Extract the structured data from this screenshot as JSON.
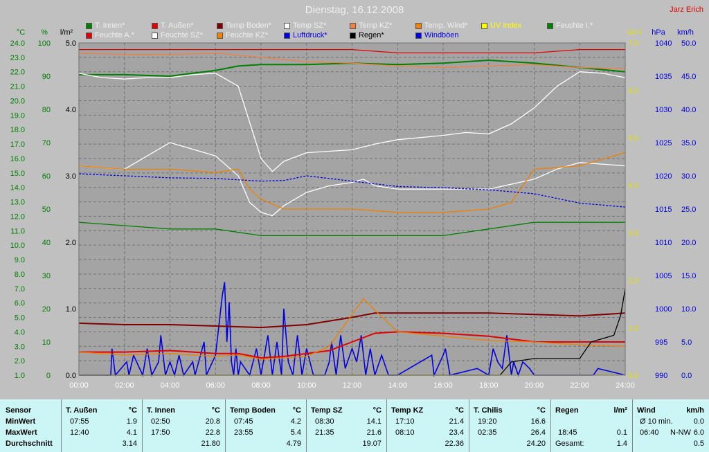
{
  "title": "Dienstag, 16.12.2008",
  "author": "Jarz Erich",
  "axes": {
    "temp_unit": "°C",
    "pct_unit": "%",
    "rain_unit": "l/m²",
    "uv_unit": "UV-I",
    "pressure_unit": "hPa",
    "wind_unit": "km/h",
    "temp_ticks": [
      "24.0",
      "23.0",
      "22.0",
      "21.0",
      "20.0",
      "19.0",
      "18.0",
      "17.0",
      "16.0",
      "15.0",
      "14.0",
      "13.0",
      "12.0",
      "11.0",
      "10.0",
      "9.0",
      "8.0",
      "7.0",
      "6.0",
      "5.0",
      "4.0",
      "3.0",
      "2.0",
      "1.0"
    ],
    "pct_ticks": [
      "100",
      "90",
      "80",
      "70",
      "60",
      "50",
      "40",
      "30",
      "20",
      "10",
      "0"
    ],
    "rain_ticks": [
      "5.0",
      "4.0",
      "3.0",
      "2.0",
      "1.0",
      "0.0"
    ],
    "uv_ticks": [
      "7.0",
      "6.0",
      "5.0",
      "4.0",
      "3.0",
      "2.0",
      "1.0",
      "0.0"
    ],
    "pressure_ticks": [
      "1040",
      "1035",
      "1030",
      "1025",
      "1020",
      "1015",
      "1010",
      "1005",
      "1000",
      "995",
      "990"
    ],
    "wind_ticks": [
      "50.0",
      "45.0",
      "40.0",
      "35.0",
      "30.0",
      "25.0",
      "20.0",
      "15.0",
      "10.0",
      "5.0",
      "0.0"
    ],
    "time_ticks": [
      "00:00",
      "02:00",
      "04:00",
      "06:00",
      "08:00",
      "10:00",
      "12:00",
      "14:00",
      "16:00",
      "18:00",
      "20:00",
      "22:00",
      "24:00"
    ]
  },
  "legend": [
    {
      "label": "T. Innen*",
      "color": "#008000"
    },
    {
      "label": "T. Außen*",
      "color": "#E00000"
    },
    {
      "label": "Temp Boden*",
      "color": "#800000"
    },
    {
      "label": "Temp SZ*",
      "color": "#FFFFFF"
    },
    {
      "label": "Temp KZ*",
      "color": "#F08040"
    },
    {
      "label": "Temp. Wind*",
      "color": "#F08000"
    },
    {
      "label": "UV Index",
      "color": "#FFFF00"
    },
    {
      "label": "Feuchte I.*",
      "color": "#008000"
    },
    {
      "label": "Feuchte A.*",
      "color": "#E00000"
    },
    {
      "label": "Feuchte SZ*",
      "color": "#FFFFFF"
    },
    {
      "label": "Feuchte KZ*",
      "color": "#F08000"
    },
    {
      "label": "Luftdruck*",
      "color": "#0000E0"
    },
    {
      "label": "Regen*",
      "color": "#000000"
    },
    {
      "label": "Windböen",
      "color": "#0000E0"
    }
  ],
  "colors": {
    "temp_axis": "#008000",
    "uv_axis": "#E0E000",
    "pressure_axis": "#0000E0",
    "plot_bg": "#A4A4A4",
    "grid": "#707070"
  },
  "chart_data": {
    "type": "line",
    "x_unit": "hours",
    "xlim": [
      0,
      24
    ],
    "temp_ylim": [
      1,
      24
    ],
    "pct_ylim": [
      0,
      100
    ],
    "rain_ylim": [
      0,
      5
    ],
    "pressure_ylim": [
      990,
      1040
    ],
    "wind_ylim": [
      0,
      50
    ],
    "series": [
      {
        "name": "T. Innen*",
        "axis": "temp",
        "color": "#008000",
        "x": [
          0,
          2,
          4,
          5,
          6,
          7,
          8,
          10,
          12,
          14,
          16,
          18,
          19,
          20,
          22,
          24
        ],
        "y": [
          21.8,
          21.8,
          21.7,
          21.9,
          22.1,
          22.4,
          22.5,
          22.5,
          22.6,
          22.5,
          22.6,
          22.8,
          22.7,
          22.6,
          22.3,
          22.0
        ]
      },
      {
        "name": "T. Außen*",
        "axis": "temp",
        "color": "#E00000",
        "x": [
          0,
          2,
          4,
          6,
          7,
          8,
          9,
          10,
          11,
          12,
          13,
          14,
          16,
          18,
          20,
          22,
          24
        ],
        "y": [
          2.6,
          2.6,
          2.7,
          2.5,
          2.5,
          2.2,
          2.3,
          2.5,
          2.7,
          3.3,
          3.9,
          4.0,
          3.9,
          3.7,
          3.3,
          3.3,
          3.3
        ]
      },
      {
        "name": "Temp Boden*",
        "axis": "temp",
        "color": "#800000",
        "x": [
          0,
          2,
          4,
          6,
          8,
          10,
          12,
          13,
          14,
          16,
          18,
          20,
          22,
          24
        ],
        "y": [
          4.6,
          4.5,
          4.5,
          4.4,
          4.3,
          4.5,
          5.0,
          5.3,
          5.3,
          5.3,
          5.3,
          5.2,
          5.1,
          5.3
        ]
      },
      {
        "name": "Temp SZ*",
        "axis": "temp",
        "color": "#FFFFFF",
        "x": [
          0,
          1,
          2,
          3,
          4,
          5,
          6,
          7,
          7.5,
          8,
          8.5,
          9,
          10,
          11,
          12,
          13,
          14,
          16,
          17,
          18,
          19,
          20,
          21,
          22,
          23,
          24
        ],
        "y": [
          21.9,
          21.6,
          21.5,
          21.6,
          21.6,
          21.8,
          21.9,
          21.0,
          18.5,
          16.0,
          15.1,
          15.8,
          16.4,
          16.5,
          16.6,
          17.0,
          17.3,
          17.6,
          17.8,
          17.7,
          18.4,
          19.5,
          21.0,
          22.0,
          21.9,
          21.6
        ]
      },
      {
        "name": "Temp KZ*",
        "axis": "temp",
        "color": "#F08040",
        "x": [
          0,
          2,
          4,
          6,
          8,
          10,
          12,
          14,
          16,
          18,
          20,
          22,
          24
        ],
        "y": [
          23.3,
          23.2,
          23.2,
          23.3,
          23.0,
          22.7,
          22.6,
          22.4,
          22.3,
          22.4,
          22.5,
          22.3,
          22.2
        ]
      },
      {
        "name": "Temp. Wind*",
        "axis": "temp",
        "color": "#F08000",
        "x": [
          0,
          2,
          4,
          6,
          7,
          8,
          9,
          10,
          11,
          12,
          12.5,
          13,
          14,
          16,
          18,
          20,
          22,
          24
        ],
        "y": [
          2.6,
          2.4,
          2.5,
          2.3,
          2.4,
          2.1,
          2.2,
          2.3,
          3.0,
          5.2,
          6.3,
          5.5,
          4.0,
          3.7,
          3.4,
          3.3,
          3.1,
          3.0
        ]
      },
      {
        "name": "Feuchte I.*",
        "axis": "pct",
        "color": "#008000",
        "x": [
          0,
          2,
          4,
          6,
          8,
          10,
          12,
          14,
          16,
          18,
          20,
          22,
          24
        ],
        "y": [
          46,
          45,
          44,
          44,
          42,
          42,
          42,
          42,
          42,
          44,
          46,
          46,
          46
        ]
      },
      {
        "name": "Feuchte A.*",
        "axis": "pct",
        "color": "#E00000",
        "x": [
          0,
          2,
          4,
          6,
          8,
          10,
          12,
          14,
          16,
          18,
          20,
          22,
          24
        ],
        "y": [
          98,
          98,
          98,
          98,
          98,
          98,
          98,
          97,
          97,
          97,
          97,
          98,
          98
        ]
      },
      {
        "name": "Feuchte SZ*",
        "axis": "pct",
        "color": "#FFFFFF",
        "x": [
          0,
          2,
          4,
          6,
          7,
          7.5,
          8,
          8.5,
          9,
          10,
          11,
          12,
          12.5,
          13,
          14,
          16,
          18,
          20,
          21,
          22,
          24
        ],
        "y": [
          63,
          62,
          70,
          66,
          60,
          52,
          49,
          48,
          51,
          55,
          57,
          58,
          59,
          57,
          56,
          56,
          56,
          59,
          62,
          64,
          63
        ]
      },
      {
        "name": "Feuchte KZ*",
        "axis": "pct",
        "color": "#F08000",
        "x": [
          0,
          2,
          4,
          6,
          7,
          7.5,
          8,
          9,
          10,
          12,
          14,
          16,
          18,
          19,
          20,
          22,
          24
        ],
        "y": [
          63,
          62,
          62,
          61,
          62,
          56,
          53,
          50,
          50,
          50,
          49,
          49,
          50,
          52,
          62,
          63,
          67
        ]
      },
      {
        "name": "Luftdruck*",
        "axis": "pressure",
        "color": "#0000E0",
        "dash": true,
        "x": [
          0,
          2,
          4,
          6,
          8,
          9,
          10,
          12,
          14,
          16,
          18,
          20,
          22,
          24
        ],
        "y": [
          1020.3,
          1020.0,
          1019.7,
          1019.6,
          1019.2,
          1019.3,
          1020.0,
          1019.2,
          1018.4,
          1018.2,
          1017.9,
          1017.3,
          1015.9,
          1015.3
        ]
      },
      {
        "name": "Regen*",
        "axis": "rain",
        "color": "#000000",
        "x": [
          0,
          18.5,
          19,
          20,
          21,
          22,
          22.5,
          23,
          23.5,
          23.8,
          24
        ],
        "y": [
          0,
          0,
          0.2,
          0.25,
          0.25,
          0.25,
          0.5,
          0.55,
          0.6,
          0.9,
          1.3
        ]
      },
      {
        "name": "UV Index",
        "axis": "uv",
        "color": "#FFFF00",
        "x": [
          0,
          24
        ],
        "y": [
          0,
          0
        ]
      }
    ],
    "gusts": {
      "name": "Windböen",
      "color": "#0000E0",
      "x": [
        0,
        0.6,
        1.4,
        1.45,
        1.6,
        2.1,
        2.2,
        2.4,
        2.8,
        3.0,
        3.2,
        3.5,
        3.6,
        3.8,
        4.0,
        4.2,
        4.4,
        4.6,
        5.0,
        5.1,
        5.5,
        5.6,
        6.0,
        6.3,
        6.4,
        6.5,
        6.6,
        6.7,
        6.8,
        6.9,
        7.0,
        7.1,
        7.5,
        7.8,
        8.0,
        8.3,
        8.5,
        8.7,
        8.9,
        9.0,
        9.2,
        9.4,
        9.6,
        9.8,
        10.0,
        10.3,
        10.8,
        11.0,
        11.1,
        11.3,
        11.5,
        11.7,
        12.0,
        12.2,
        12.4,
        12.6,
        12.8,
        13.0,
        13.3,
        13.6,
        13.8,
        14.0,
        15.5,
        15.6,
        16.0,
        16.1,
        16.3,
        17.5,
        18.0,
        18.2,
        18.4,
        18.6,
        18.8,
        19.0,
        19.1,
        19.3,
        19.5,
        19.8,
        20.0,
        22.6,
        22.8,
        24
      ],
      "y": [
        0,
        0,
        0,
        4,
        0,
        2,
        0,
        3,
        0,
        4,
        0,
        2,
        6,
        0,
        2,
        0,
        3,
        0,
        2,
        0,
        5,
        0,
        3,
        12,
        14,
        5,
        11,
        2,
        0,
        4,
        0,
        2,
        0,
        4,
        0,
        6,
        0,
        5,
        0,
        10,
        2,
        0,
        6,
        0,
        4,
        0,
        0,
        2,
        5,
        0,
        6,
        1,
        4,
        2,
        6,
        0,
        4,
        0,
        3,
        0,
        0,
        0,
        3,
        0,
        3,
        4,
        0,
        1,
        0,
        4,
        2,
        1,
        6,
        0,
        2,
        0,
        2,
        1,
        0,
        0,
        1,
        0
      ],
      "ylim": [
        0,
        50
      ]
    }
  },
  "summary": {
    "row_labels": {
      "sensor": "Sensor",
      "min": "MinWert",
      "max": "MaxWert",
      "avg": "Durchschnitt"
    },
    "columns": [
      {
        "name": "T. Außen",
        "unit": "°C",
        "min_time": "07:55",
        "min_val": "1.9",
        "max_time": "12:40",
        "max_val": "4.1",
        "avg": "3.14"
      },
      {
        "name": "T. Innen",
        "unit": "°C",
        "min_time": "02:50",
        "min_val": "20.8",
        "max_time": "17:50",
        "max_val": "22.8",
        "avg": "21.80"
      },
      {
        "name": "Temp Boden",
        "unit": "°C",
        "min_time": "07:45",
        "min_val": "4.2",
        "max_time": "23:55",
        "max_val": "5.4",
        "avg": "4.79"
      },
      {
        "name": "Temp SZ",
        "unit": "°C",
        "min_time": "08:30",
        "min_val": "14.1",
        "max_time": "21:35",
        "max_val": "21.6",
        "avg": "19.07"
      },
      {
        "name": "Temp KZ",
        "unit": "°C",
        "min_time": "17:10",
        "min_val": "21.4",
        "max_time": "08:10",
        "max_val": "23.4",
        "avg": "22.36"
      },
      {
        "name": "T. Chilis",
        "unit": "°C",
        "min_time": "19:20",
        "min_val": "16.6",
        "max_time": "02:35",
        "max_val": "26.4",
        "avg": "24.20"
      }
    ],
    "rain": {
      "name": "Regen",
      "unit": "l/m²",
      "max_time": "18:45",
      "max_val": "0.1",
      "total_label": "Gesamt:",
      "total_val": "1.4"
    },
    "wind": {
      "name": "Wind",
      "unit": "km/h",
      "min_label": "Ø 10 min.",
      "min_val": "0.0",
      "max_time": "06:40",
      "max_dir": "N-NW",
      "max_val": "6.0",
      "avg": "0.5"
    }
  }
}
